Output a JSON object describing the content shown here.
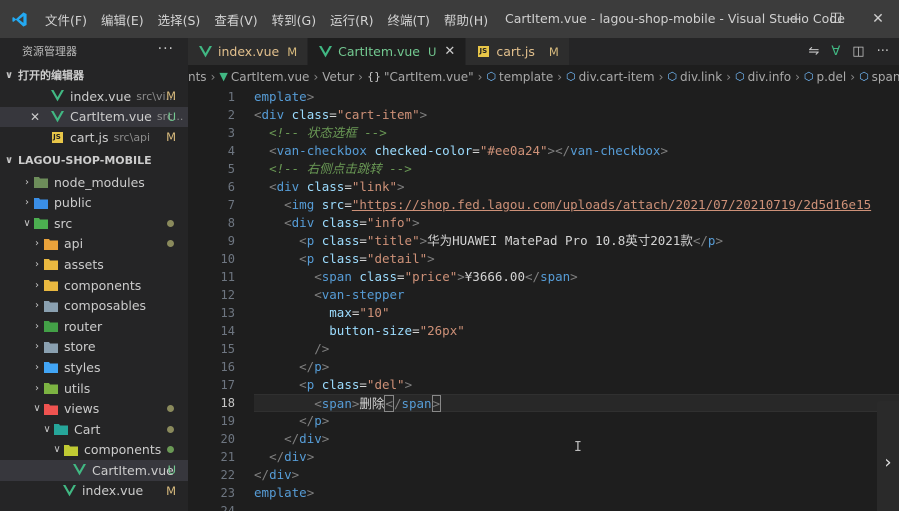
{
  "titlebar": {
    "menu": [
      "文件(F)",
      "编辑(E)",
      "选择(S)",
      "查看(V)",
      "转到(G)",
      "运行(R)",
      "终端(T)",
      "帮助(H)"
    ],
    "title": "CartItem.vue - lagou-shop-mobile - Visual Studio Code"
  },
  "sidebar": {
    "header": "资源管理器",
    "open_editors_title": "打开的编辑器",
    "open_editors": [
      {
        "name": "index.vue",
        "desc": "src\\vi...",
        "badge": "M"
      },
      {
        "name": "CartItem.vue",
        "desc": "src...",
        "badge": "U"
      },
      {
        "name": "cart.js",
        "desc": "src\\api",
        "badge": "M"
      }
    ],
    "project_title": "LAGOU-SHOP-MOBILE",
    "tree": [
      {
        "name": "node_modules"
      },
      {
        "name": "public"
      },
      {
        "name": "src"
      },
      {
        "name": "api"
      },
      {
        "name": "assets"
      },
      {
        "name": "components"
      },
      {
        "name": "composables"
      },
      {
        "name": "router"
      },
      {
        "name": "store"
      },
      {
        "name": "styles"
      },
      {
        "name": "utils"
      },
      {
        "name": "views"
      },
      {
        "name": "Cart"
      },
      {
        "name": "components"
      },
      {
        "name": "CartItem.vue",
        "badge": "U"
      },
      {
        "name": "index.vue",
        "badge": "M"
      }
    ]
  },
  "tabs": [
    {
      "name": "index.vue",
      "badge": "M"
    },
    {
      "name": "CartItem.vue",
      "badge": "U"
    },
    {
      "name": "cart.js",
      "badge": "M"
    }
  ],
  "breadcrumb": {
    "items": [
      "nts",
      "CartItem.vue",
      "Vetur",
      "\"CartItem.vue\"",
      "template",
      "div.cart-item",
      "div.link",
      "div.info",
      "p.del",
      "span"
    ]
  },
  "editor": {
    "line_numbers": [
      "1",
      "2",
      "3",
      "4",
      "5",
      "6",
      "7",
      "8",
      "9",
      "10",
      "11",
      "12",
      "13",
      "14",
      "15",
      "16",
      "17",
      "18",
      "19",
      "20",
      "21",
      "22",
      "23",
      "24"
    ],
    "current_line": "18",
    "strings": {
      "tag_template": "emplate",
      "tag_div": "div",
      "tag_van_checkbox": "van-checkbox",
      "tag_img": "img",
      "tag_p": "p",
      "tag_span": "span",
      "tag_van_stepper": "van-stepper",
      "attr_class": "class",
      "attr_checked_color": "checked-color",
      "attr_src": "src",
      "attr_max": "max",
      "attr_button_size": "button-size",
      "val_cart_item": "\"cart-item\"",
      "val_color": "\"#ee0a24\"",
      "val_link": "\"link\"",
      "val_url": "\"https://shop.fed.lagou.com/uploads/attach/2021/07/20210719/2d5d16e15",
      "val_info": "\"info\"",
      "val_title": "\"title\"",
      "val_detail": "\"detail\"",
      "val_price": "\"price\"",
      "val_max": "\"10\"",
      "val_button_size": "\"26px\"",
      "val_del": "\"del\"",
      "comment_state": "<!-- 状态选框 -->",
      "comment_right": "<!-- 右侧点击跳转 -->",
      "text_title": "华为HUAWEI MatePad Pro 10.8英寸2021款",
      "text_price": "¥3666.00",
      "text_delete": "删除"
    }
  }
}
